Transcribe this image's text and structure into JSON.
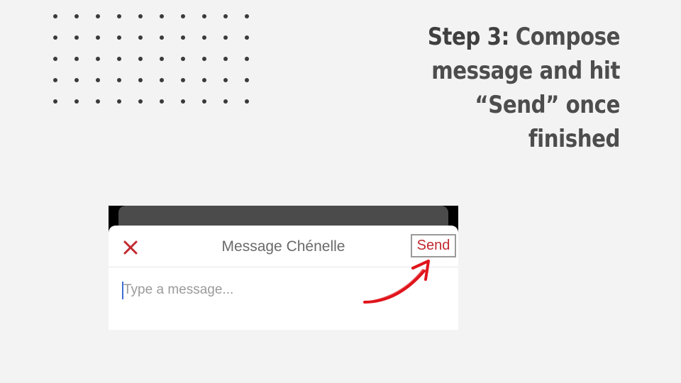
{
  "slide": {
    "heading_step": "Step 3:",
    "heading_line1": "Compose",
    "heading_line2": "message and hit",
    "heading_line3": "“Send” once",
    "heading_line4": "finished"
  },
  "compose_sheet": {
    "close_icon": "close-icon",
    "title": "Message Chénelle",
    "send_label": "Send",
    "input_placeholder": "Type a message...",
    "input_value": ""
  },
  "colors": {
    "background": "#f3f3f3",
    "heading_text": "#3f3f3f",
    "accent_red": "#c0292f",
    "caret_blue": "#3d6fd6",
    "annotation_arrow": "#e0141b"
  },
  "annotation": {
    "icon": "red-arrow-icon"
  }
}
